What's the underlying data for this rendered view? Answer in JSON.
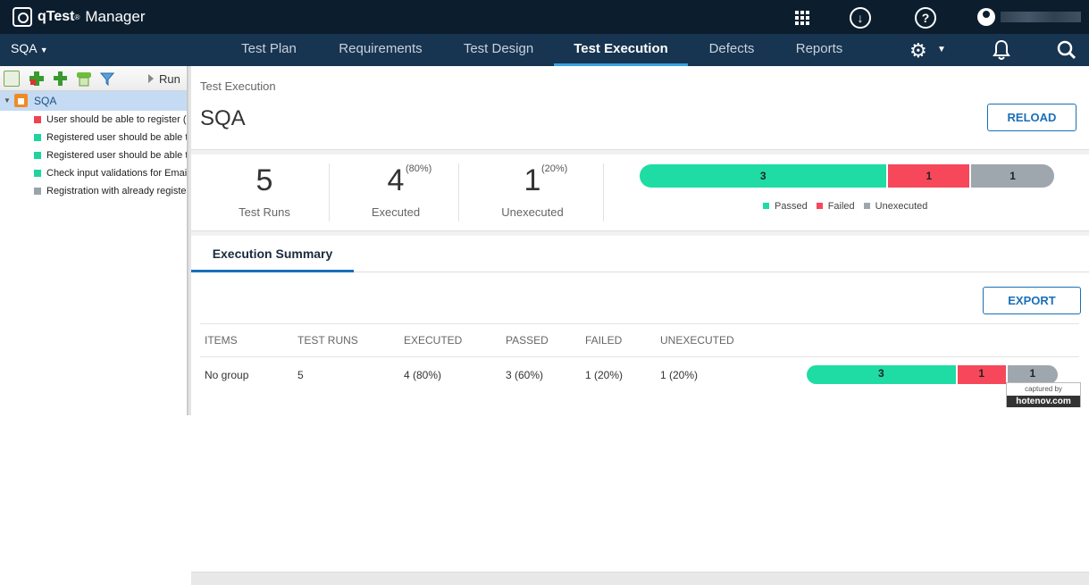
{
  "app": {
    "logo_q": "qTest",
    "logo_tm": "®",
    "logo_manager": "Manager"
  },
  "topbar": {
    "help_glyph": "?",
    "download_glyph": "↓"
  },
  "nav": {
    "project": "SQA",
    "tabs": [
      {
        "label": "Test Plan",
        "active": false
      },
      {
        "label": "Requirements",
        "active": false
      },
      {
        "label": "Test Design",
        "active": false
      },
      {
        "label": "Test Execution",
        "active": true
      },
      {
        "label": "Defects",
        "active": false
      },
      {
        "label": "Reports",
        "active": false
      }
    ]
  },
  "tree": {
    "run_label": "Run",
    "root": "SQA",
    "items": [
      {
        "label": "User should be able to register (",
        "status_color": "#f0424f"
      },
      {
        "label": "Registered user should be able t",
        "status_color": "#1fd49e"
      },
      {
        "label": "Registered user should be able t",
        "status_color": "#1fd49e"
      },
      {
        "label": "Check input validations for Emai",
        "status_color": "#1fd49e"
      },
      {
        "label": "Registration with already registe",
        "status_color": "#9aa3ab"
      }
    ]
  },
  "main": {
    "breadcrumb": "Test Execution",
    "title": "SQA",
    "reload_label": "RELOAD",
    "export_label": "EXPORT"
  },
  "stats": {
    "test_runs": {
      "value": "5",
      "label": "Test Runs"
    },
    "executed": {
      "value": "4",
      "pct": "(80%)",
      "label": "Executed"
    },
    "unexecuted": {
      "value": "1",
      "pct": "(20%)",
      "label": "Unexecuted"
    }
  },
  "progress": {
    "segments": [
      {
        "label": "3",
        "fraction": 0.6,
        "color": "#1fdca4"
      },
      {
        "label": "1",
        "fraction": 0.2,
        "color": "#f6485a"
      },
      {
        "label": "1",
        "fraction": 0.2,
        "color": "#9ea6ae"
      }
    ]
  },
  "legend": [
    {
      "label": "Passed",
      "color": "#1fdca4"
    },
    {
      "label": "Failed",
      "color": "#f6485a"
    },
    {
      "label": "Unexecuted",
      "color": "#9ea6ae"
    }
  ],
  "summary": {
    "tab_label": "Execution Summary",
    "headers": [
      "ITEMS",
      "TEST RUNS",
      "EXECUTED",
      "PASSED",
      "FAILED",
      "UNEXECUTED"
    ],
    "rows": [
      {
        "cells": [
          "No group",
          "5",
          "4 (80%)",
          "3 (60%)",
          "1 (20%)",
          "1 (20%)"
        ]
      }
    ]
  },
  "watermark": {
    "top": "captured by",
    "brand": "hotenov.com"
  }
}
